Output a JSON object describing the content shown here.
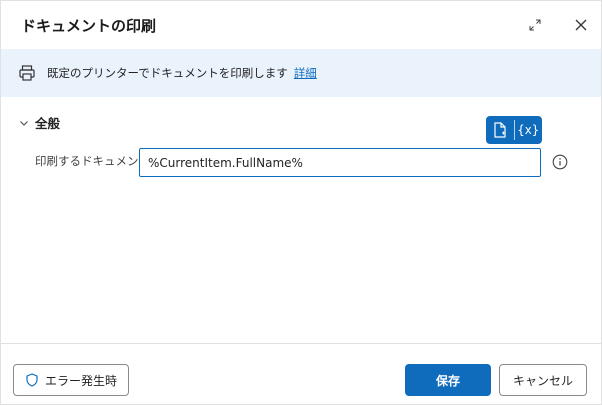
{
  "dialog": {
    "title": "ドキュメントの印刷"
  },
  "banner": {
    "text": "既定のプリンターでドキュメントを印刷します",
    "link": "詳細"
  },
  "section": {
    "label": "全般"
  },
  "field": {
    "label": "印刷するドキュメント:",
    "value": "%CurrentItem.FullName%"
  },
  "picker": {
    "variable_label": "{x}"
  },
  "footer": {
    "error_label": "エラー発生時",
    "save_label": "保存",
    "cancel_label": "キャンセル"
  },
  "colors": {
    "accent": "#0f6cbd",
    "banner_bg": "#eaf2fc"
  }
}
